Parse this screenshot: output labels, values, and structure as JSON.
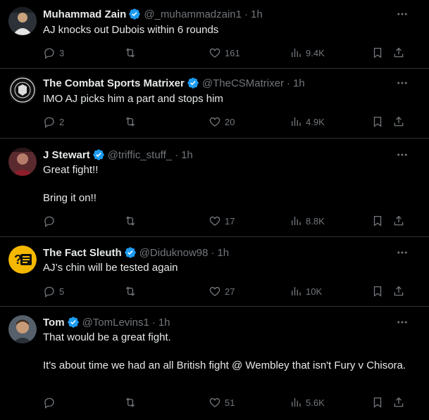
{
  "colors": {
    "background": "#000000",
    "text": "#e7e9ea",
    "muted": "#71767b",
    "verified": "#1d9bf0",
    "divider": "#2f3336"
  },
  "tweets": [
    {
      "name": "Muhammad Zain",
      "handle": "@_muhammadzain1",
      "time": "1h",
      "text": [
        "AJ knocks out Dubois within 6 rounds"
      ],
      "replies": "3",
      "reposts": "",
      "likes": "161",
      "views": "9.4K",
      "avatar_icon": "profile-photo"
    },
    {
      "name": "The Combat Sports Matrixer",
      "handle": "@TheCSMatrixer",
      "time": "1h",
      "text": [
        "IMO AJ picks him a part and stops him"
      ],
      "replies": "2",
      "reposts": "",
      "likes": "20",
      "views": "4.9K",
      "avatar_icon": "combat-sports-logo"
    },
    {
      "name": "J Stewart",
      "handle": "@triffic_stuff_",
      "time": "1h",
      "text": [
        "Great fight!!",
        "Bring it on!!"
      ],
      "replies": "",
      "reposts": "",
      "likes": "17",
      "views": "8.8K",
      "avatar_icon": "profile-photo"
    },
    {
      "name": "The Fact Sleuth",
      "handle": "@Diduknow98",
      "time": "1h",
      "text": [
        "AJ’s chin will be tested again"
      ],
      "replies": "5",
      "reposts": "",
      "likes": "27",
      "views": "10K",
      "avatar_icon": "fact-sleuth-logo"
    },
    {
      "name": "Tom",
      "handle": "@TomLevins1",
      "time": "1h",
      "text": [
        "That would be a great fight.",
        "It's about time we had an all British fight @ Wembley that isn't Fury v Chisora."
      ],
      "replies": "",
      "reposts": "",
      "likes": "51",
      "views": "5.6K",
      "avatar_icon": "profile-photo"
    }
  ]
}
